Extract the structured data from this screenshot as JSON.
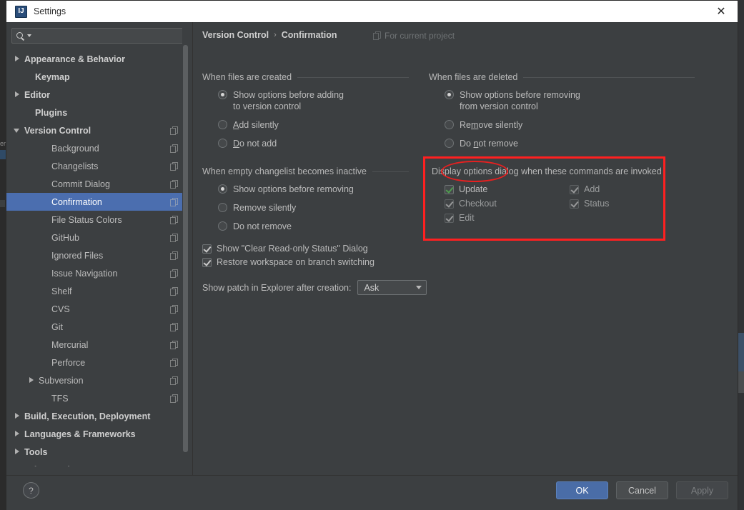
{
  "window": {
    "title": "Settings",
    "app_icon": "intellij-idea-icon",
    "close_label": "✕"
  },
  "sidebar": {
    "search": {
      "value": "",
      "placeholder": ""
    },
    "items": [
      {
        "label": "Appearance & Behavior",
        "indent": 10,
        "arrow": "right",
        "bold": true,
        "copy": false,
        "selected": false
      },
      {
        "label": "Keymap",
        "indent": 25,
        "arrow": "none",
        "bold": true,
        "copy": false,
        "selected": false
      },
      {
        "label": "Editor",
        "indent": 10,
        "arrow": "right",
        "bold": true,
        "copy": false,
        "selected": false
      },
      {
        "label": "Plugins",
        "indent": 25,
        "arrow": "none",
        "bold": true,
        "copy": false,
        "selected": false
      },
      {
        "label": "Version Control",
        "indent": 10,
        "arrow": "down",
        "bold": true,
        "copy": true,
        "selected": false
      },
      {
        "label": "Background",
        "indent": 48,
        "arrow": "none",
        "bold": false,
        "copy": true,
        "selected": false
      },
      {
        "label": "Changelists",
        "indent": 48,
        "arrow": "none",
        "bold": false,
        "copy": true,
        "selected": false
      },
      {
        "label": "Commit Dialog",
        "indent": 48,
        "arrow": "none",
        "bold": false,
        "copy": true,
        "selected": false
      },
      {
        "label": "Confirmation",
        "indent": 48,
        "arrow": "none",
        "bold": false,
        "copy": true,
        "selected": true
      },
      {
        "label": "File Status Colors",
        "indent": 48,
        "arrow": "none",
        "bold": false,
        "copy": true,
        "selected": false
      },
      {
        "label": "GitHub",
        "indent": 48,
        "arrow": "none",
        "bold": false,
        "copy": true,
        "selected": false
      },
      {
        "label": "Ignored Files",
        "indent": 48,
        "arrow": "none",
        "bold": false,
        "copy": true,
        "selected": false
      },
      {
        "label": "Issue Navigation",
        "indent": 48,
        "arrow": "none",
        "bold": false,
        "copy": true,
        "selected": false
      },
      {
        "label": "Shelf",
        "indent": 48,
        "arrow": "none",
        "bold": false,
        "copy": true,
        "selected": false
      },
      {
        "label": "CVS",
        "indent": 48,
        "arrow": "none",
        "bold": false,
        "copy": true,
        "selected": false
      },
      {
        "label": "Git",
        "indent": 48,
        "arrow": "none",
        "bold": false,
        "copy": true,
        "selected": false
      },
      {
        "label": "Mercurial",
        "indent": 48,
        "arrow": "none",
        "bold": false,
        "copy": true,
        "selected": false
      },
      {
        "label": "Perforce",
        "indent": 48,
        "arrow": "none",
        "bold": false,
        "copy": true,
        "selected": false
      },
      {
        "label": "Subversion",
        "indent": 30,
        "arrow": "right",
        "bold": false,
        "copy": true,
        "selected": false
      },
      {
        "label": "TFS",
        "indent": 48,
        "arrow": "none",
        "bold": false,
        "copy": true,
        "selected": false
      },
      {
        "label": "Build, Execution, Deployment",
        "indent": 10,
        "arrow": "right",
        "bold": true,
        "copy": false,
        "selected": false
      },
      {
        "label": "Languages & Frameworks",
        "indent": 10,
        "arrow": "right",
        "bold": true,
        "copy": false,
        "selected": false
      },
      {
        "label": "Tools",
        "indent": 10,
        "arrow": "right",
        "bold": true,
        "copy": false,
        "selected": false
      },
      {
        "label": "Other Settings",
        "indent": 10,
        "arrow": "right",
        "bold": true,
        "copy": false,
        "selected": false
      }
    ]
  },
  "content": {
    "breadcrumb": {
      "parent": "Version Control",
      "separator": "›",
      "current": "Confirmation"
    },
    "scope": {
      "label": "For current project",
      "icon": "copy-icon"
    },
    "created": {
      "title": "When files are created",
      "options": [
        {
          "label": "Show options before adding\nto version control",
          "selected": true,
          "mnemonic": ""
        },
        {
          "label": "Add silently",
          "selected": false,
          "mnemonic": "A"
        },
        {
          "label": "Do not add",
          "selected": false,
          "mnemonic": "D"
        }
      ]
    },
    "deleted": {
      "title": "When files are deleted",
      "options": [
        {
          "label": "Show options before removing\nfrom version control",
          "selected": true,
          "mnemonic": ""
        },
        {
          "label": "Remove silently",
          "selected": false,
          "mnemonic": "m"
        },
        {
          "label": "Do not remove",
          "selected": false,
          "mnemonic": "n"
        }
      ]
    },
    "changelist": {
      "title": "When empty changelist becomes inactive",
      "options": [
        {
          "label": "Show options before removing",
          "selected": true,
          "mnemonic": ""
        },
        {
          "label": "Remove silently",
          "selected": false,
          "mnemonic": ""
        },
        {
          "label": "Do not remove",
          "selected": false,
          "mnemonic": ""
        }
      ]
    },
    "commands": {
      "title": "Display options dialog when these commands are invoked",
      "highlight_color": "#ff2020",
      "annotation": "ellipse-around-update",
      "column1": [
        {
          "label": "Update",
          "checked": true,
          "accent": true
        },
        {
          "label": "Checkout",
          "checked": true,
          "accent": false
        },
        {
          "label": "Edit",
          "checked": true,
          "accent": false
        }
      ],
      "column2": [
        {
          "label": "Add",
          "checked": true,
          "accent": false
        },
        {
          "label": "Status",
          "checked": true,
          "accent": false
        }
      ]
    },
    "toggles": [
      {
        "label": "Show \"Clear Read-only Status\" Dialog",
        "checked": true
      },
      {
        "label": "Restore workspace on branch switching",
        "checked": true
      }
    ],
    "patch": {
      "label": "Show patch in Explorer after creation:",
      "value": "Ask"
    }
  },
  "footer": {
    "help_label": "?",
    "ok_label": "OK",
    "cancel_label": "Cancel",
    "apply_label": "Apply"
  },
  "colors": {
    "accent_blue": "#4b6eaf",
    "highlight_red": "#ff2020",
    "panel_bg": "#3c3f41",
    "check_green": "#4f9d4f"
  }
}
